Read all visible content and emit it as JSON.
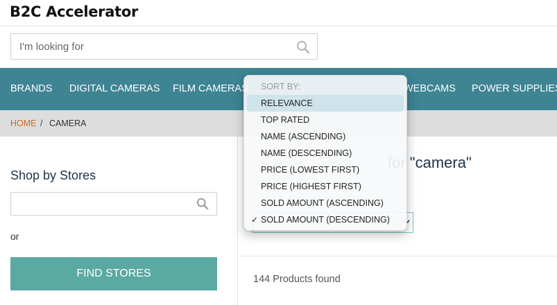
{
  "header": {
    "logo": "B2C Accelerator",
    "search_placeholder": "I'm looking for"
  },
  "nav": {
    "items": [
      {
        "label": "BRANDS"
      },
      {
        "label": "DIGITAL CAMERAS"
      },
      {
        "label": "FILM CAMERAS"
      },
      {
        "label": "WEBCAMS"
      },
      {
        "label": "POWER SUPPLIES"
      }
    ]
  },
  "breadcrumb": {
    "home": "HOME",
    "separator": "/",
    "current": "CAMERA"
  },
  "sidebar": {
    "title": "Shop by Stores",
    "store_search_placeholder": "",
    "or_label": "or",
    "find_button": "FIND STORES"
  },
  "main": {
    "results_title_fragment": "for \"camera\"",
    "products_found": "144 Products found"
  },
  "sort_dropdown": {
    "heading": "SORT BY:",
    "selected_value": "SOLD AMOUNT (DESCENDING)",
    "options": [
      {
        "label": "RELEVANCE",
        "highlighted": true,
        "checked": false
      },
      {
        "label": "TOP RATED",
        "highlighted": false,
        "checked": false
      },
      {
        "label": "NAME (ASCENDING)",
        "highlighted": false,
        "checked": false
      },
      {
        "label": "NAME (DESCENDING)",
        "highlighted": false,
        "checked": false
      },
      {
        "label": "PRICE (LOWEST FIRST)",
        "highlighted": false,
        "checked": false
      },
      {
        "label": "PRICE (HIGHEST FIRST)",
        "highlighted": false,
        "checked": false
      },
      {
        "label": "SOLD AMOUNT (ASCENDING)",
        "highlighted": false,
        "checked": false
      },
      {
        "label": "SOLD AMOUNT (DESCENDING)",
        "highlighted": false,
        "checked": true
      }
    ],
    "check_glyph": "✓"
  },
  "colors": {
    "nav_bg": "#3e8493",
    "breadcrumb_bg": "#dddddd",
    "home_link": "#d2691e",
    "find_button_bg": "#5aa9a2",
    "title_color": "#20354a"
  }
}
